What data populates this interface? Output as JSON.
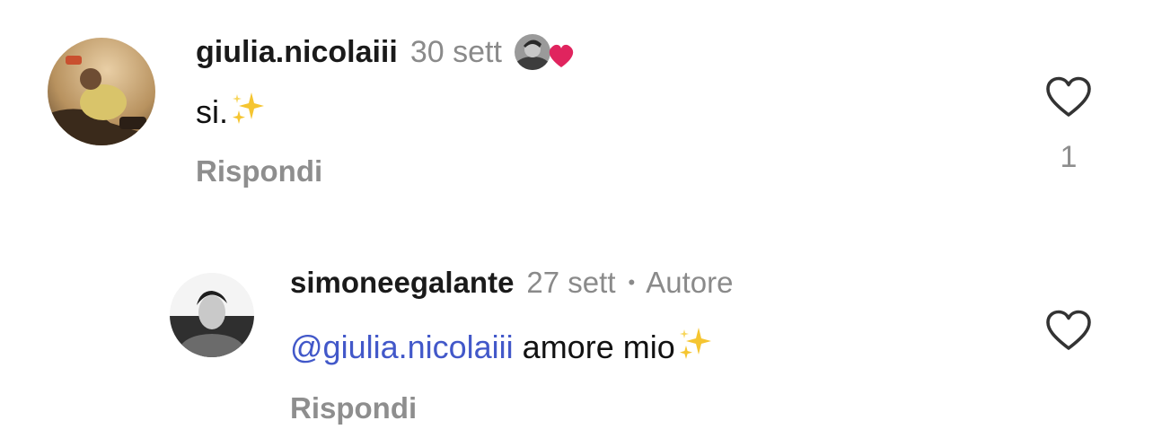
{
  "comments": [
    {
      "username": "giulia.nicolaiii",
      "time": "30 sett",
      "text": "si.",
      "reply_label": "Rispondi",
      "like_count": "1",
      "author_liked": true
    },
    {
      "username": "simoneegalante",
      "time": "27 sett",
      "separator": "•",
      "badge": "Autore",
      "mention": "@giulia.nicolaiii",
      "text": " amore mio",
      "reply_label": "Rispondi",
      "like_count": ""
    }
  ],
  "icons": {
    "like": "heart-outline-icon",
    "sparkles": "sparkles-emoji",
    "author_like_badge": "avatar-with-red-heart",
    "mention_prefix": "threads-at-icon"
  },
  "colors": {
    "mention": "#4258c9",
    "muted": "#8e8e8e",
    "heart_red": "#e0245e",
    "sparkle": "#f5c531"
  }
}
